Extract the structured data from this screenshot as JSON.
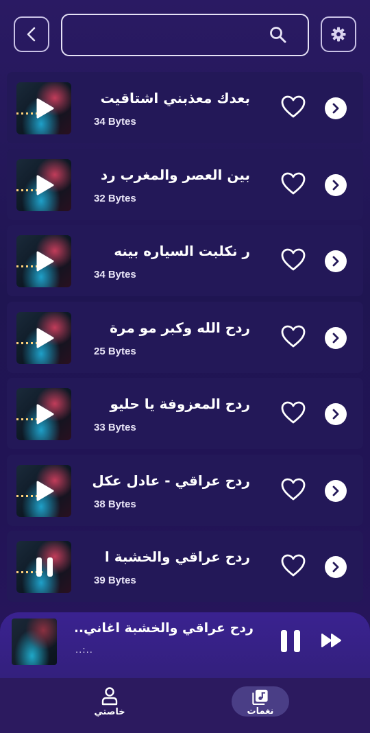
{
  "header": {
    "search_placeholder": "",
    "back_icon": "chevron-left-icon",
    "search_icon": "search-icon",
    "settings_icon": "gear-icon"
  },
  "tracks": [
    {
      "title": "بعدك معذبني اشتاقيت",
      "size": "34 Bytes",
      "state": "play"
    },
    {
      "title": "بين العصر والمغرب رد",
      "size": "32 Bytes",
      "state": "play"
    },
    {
      "title": "ر نكلبت السياره بينه",
      "size": "34 Bytes",
      "state": "play"
    },
    {
      "title": "ردح الله وكبر مو مرة",
      "size": "25 Bytes",
      "state": "play"
    },
    {
      "title": "ردح المعزوفة يا حليو",
      "size": "33 Bytes",
      "state": "play"
    },
    {
      "title": "ردح عراقي - عادل عكل",
      "size": "38 Bytes",
      "state": "play"
    },
    {
      "title": "ردح عراقي والخشبة ا",
      "size": "39 Bytes",
      "state": "pause"
    }
  ],
  "player": {
    "title": "ردح عراقي والخشبة  اغاني...",
    "time": "..:..",
    "pause_icon": "pause-icon",
    "next_icon": "fast-forward-icon"
  },
  "nav": {
    "mine_label": "خاصتي",
    "tones_label": "نغمات"
  },
  "colors": {
    "background": "#1f1552",
    "card": "#231858",
    "player": "#3a2290",
    "nav_active_pill": "#4a3e86"
  }
}
